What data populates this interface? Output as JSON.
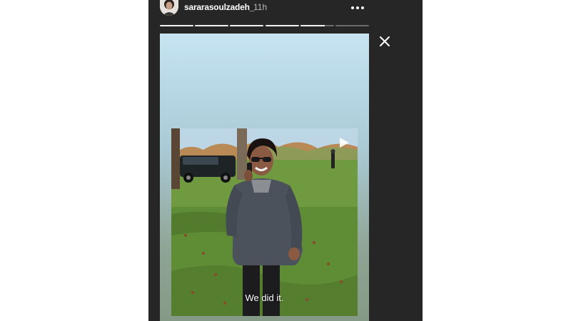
{
  "header": {
    "username": "sararasoulzadeh_",
    "time_ago": "11h",
    "avatar_icon": "profile-avatar",
    "more_icon": "more-horizontal-icon"
  },
  "story": {
    "segments_total": 6,
    "segments_completed": 4,
    "current_segment_progress": 0.72,
    "caption": "We did it.",
    "play_icon": "play-icon"
  },
  "controls": {
    "close_icon": "close-icon"
  },
  "colors": {
    "viewer_background": "#262626",
    "progress_active": "#f2f2f2",
    "progress_inactive": "#6b6b6b"
  }
}
